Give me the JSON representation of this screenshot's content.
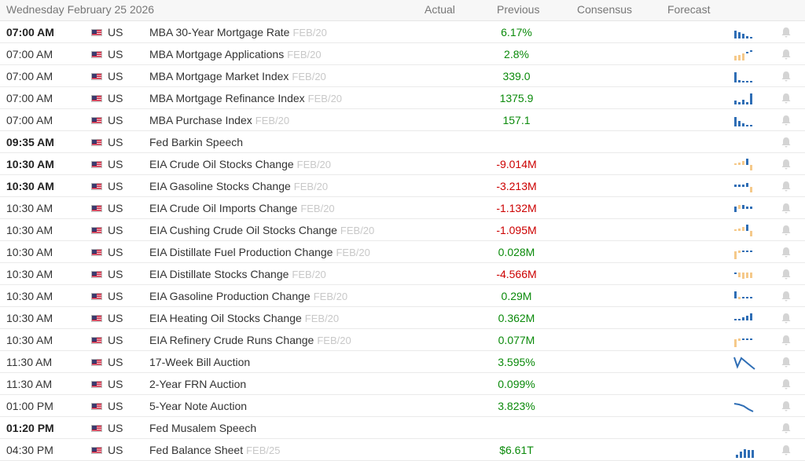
{
  "header": {
    "date": "Wednesday February 25 2026",
    "actual": "Actual",
    "previous": "Previous",
    "consensus": "Consensus",
    "forecast": "Forecast"
  },
  "colors": {
    "positive": "#0a8a0a",
    "negative": "#cc0000",
    "spark_blue": "#2f6eb5",
    "spark_orange": "#f5c98a"
  },
  "rows": [
    {
      "time": "07:00 AM",
      "bold": true,
      "country": "US",
      "event": "MBA 30-Year Mortgage Rate",
      "ref": "FEB/20",
      "previous": "6.17%",
      "sign": "pos",
      "spark": "bars-blue-desc"
    },
    {
      "time": "07:00 AM",
      "bold": false,
      "country": "US",
      "event": "MBA Mortgage Applications",
      "ref": "FEB/20",
      "previous": "2.8%",
      "sign": "pos",
      "spark": "bars-orange"
    },
    {
      "time": "07:00 AM",
      "bold": false,
      "country": "US",
      "event": "MBA Mortgage Market Index",
      "ref": "FEB/20",
      "previous": "339.0",
      "sign": "pos",
      "spark": "bars-blue-first"
    },
    {
      "time": "07:00 AM",
      "bold": false,
      "country": "US",
      "event": "MBA Mortgage Refinance Index",
      "ref": "FEB/20",
      "previous": "1375.9",
      "sign": "pos",
      "spark": "bars-blue-last"
    },
    {
      "time": "07:00 AM",
      "bold": false,
      "country": "US",
      "event": "MBA Purchase Index",
      "ref": "FEB/20",
      "previous": "157.1",
      "sign": "pos",
      "spark": "bars-blue-desc2"
    },
    {
      "time": "09:35 AM",
      "bold": true,
      "country": "US",
      "event": "Fed Barkin Speech",
      "ref": "",
      "previous": "",
      "sign": "",
      "spark": ""
    },
    {
      "time": "10:30 AM",
      "bold": true,
      "country": "US",
      "event": "EIA Crude Oil Stocks Change",
      "ref": "FEB/20",
      "previous": "-9.014M",
      "sign": "neg",
      "spark": "mixed-1"
    },
    {
      "time": "10:30 AM",
      "bold": true,
      "country": "US",
      "event": "EIA Gasoline Stocks Change",
      "ref": "FEB/20",
      "previous": "-3.213M",
      "sign": "neg",
      "spark": "mixed-2"
    },
    {
      "time": "10:30 AM",
      "bold": false,
      "country": "US",
      "event": "EIA Crude Oil Imports Change",
      "ref": "FEB/20",
      "previous": "-1.132M",
      "sign": "neg",
      "spark": "mixed-3"
    },
    {
      "time": "10:30 AM",
      "bold": false,
      "country": "US",
      "event": "EIA Cushing Crude Oil Stocks Change",
      "ref": "FEB/20",
      "previous": "-1.095M",
      "sign": "neg",
      "spark": "mixed-1"
    },
    {
      "time": "10:30 AM",
      "bold": false,
      "country": "US",
      "event": "EIA Distillate Fuel Production Change",
      "ref": "FEB/20",
      "previous": "0.028M",
      "sign": "pos",
      "spark": "mixed-4"
    },
    {
      "time": "10:30 AM",
      "bold": false,
      "country": "US",
      "event": "EIA Distillate Stocks Change",
      "ref": "FEB/20",
      "previous": "-4.566M",
      "sign": "neg",
      "spark": "mixed-5"
    },
    {
      "time": "10:30 AM",
      "bold": false,
      "country": "US",
      "event": "EIA Gasoline Production Change",
      "ref": "FEB/20",
      "previous": "0.29M",
      "sign": "pos",
      "spark": "mixed-6"
    },
    {
      "time": "10:30 AM",
      "bold": false,
      "country": "US",
      "event": "EIA Heating Oil Stocks Change",
      "ref": "FEB/20",
      "previous": "0.362M",
      "sign": "pos",
      "spark": "mixed-7"
    },
    {
      "time": "10:30 AM",
      "bold": false,
      "country": "US",
      "event": "EIA Refinery Crude Runs Change",
      "ref": "FEB/20",
      "previous": "0.077M",
      "sign": "pos",
      "spark": "mixed-4"
    },
    {
      "time": "11:30 AM",
      "bold": false,
      "country": "US",
      "event": "17-Week Bill Auction",
      "ref": "",
      "previous": "3.595%",
      "sign": "pos",
      "spark": "line-zigzag"
    },
    {
      "time": "11:30 AM",
      "bold": false,
      "country": "US",
      "event": "2-Year FRN Auction",
      "ref": "",
      "previous": "0.099%",
      "sign": "pos",
      "spark": ""
    },
    {
      "time": "01:00 PM",
      "bold": false,
      "country": "US",
      "event": "5-Year Note Auction",
      "ref": "",
      "previous": "3.823%",
      "sign": "pos",
      "spark": "line-down"
    },
    {
      "time": "01:20 PM",
      "bold": true,
      "country": "US",
      "event": "Fed Musalem Speech",
      "ref": "",
      "previous": "",
      "sign": "",
      "spark": ""
    },
    {
      "time": "04:30 PM",
      "bold": false,
      "country": "US",
      "event": "Fed Balance Sheet",
      "ref": "FEB/25",
      "previous": "$6.61T",
      "sign": "pos",
      "spark": "bars-blue-rise"
    }
  ]
}
